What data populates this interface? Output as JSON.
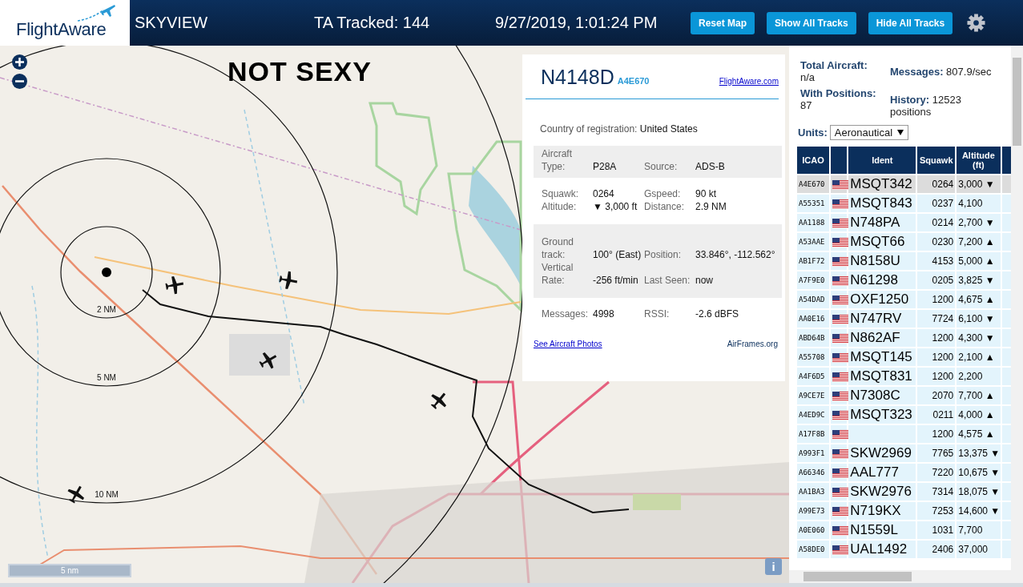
{
  "header": {
    "logo": "FlightAware",
    "app_name": "SKYVIEW",
    "tracked": "TA Tracked: 144",
    "datetime": "9/27/2019, 1:01:24 PM",
    "buttons": [
      "Reset Map",
      "Show All Tracks",
      "Hide All Tracks"
    ]
  },
  "map": {
    "kind": "picture",
    "overlay_title": "NOT SEXY",
    "rings": [
      "2 NM",
      "5 NM",
      "10 NM"
    ],
    "scale": "5 nm",
    "info_button": "i"
  },
  "popup": {
    "title": "N4148D",
    "hex": "A4E670",
    "link": "FlightAware.com",
    "country": {
      "label": "Country of registration:",
      "value": "United States"
    },
    "sections": [
      {
        "shaded": true,
        "fields": [
          {
            "label": "Aircraft Type:",
            "value": "P28A"
          },
          {
            "label": "Source:",
            "value": "ADS-B"
          }
        ]
      },
      {
        "shaded": false,
        "fields": [
          {
            "label": "Squawk:",
            "value": "0264"
          },
          {
            "label": "Gspeed:",
            "value": "90 kt"
          },
          {
            "label": "Altitude:",
            "value": "▼ 3,000 ft"
          },
          {
            "label": "Distance:",
            "value": "2.9 NM"
          }
        ]
      },
      {
        "shaded": true,
        "fields": [
          {
            "label": "Ground track:",
            "value": "100° (East)"
          },
          {
            "label": "Position:",
            "value": "33.846°, -112.562°"
          },
          {
            "label": "Vertical Rate:",
            "value": "-256 ft/min"
          },
          {
            "label": "Last Seen:",
            "value": "now"
          }
        ]
      },
      {
        "shaded": false,
        "fields": [
          {
            "label": "Messages:",
            "value": "4998"
          },
          {
            "label": "RSSI:",
            "value": "-2.6 dBFS"
          }
        ]
      }
    ],
    "photos_link": "See Aircraft Photos",
    "airframes_link": "AirFrames.org"
  },
  "stats": [
    {
      "label": "Total Aircraft:",
      "value": "n/a"
    },
    {
      "label": "Messages:",
      "value": "807.9/sec"
    },
    {
      "label": "With Positions:",
      "value": "87"
    },
    {
      "label": "History:",
      "value": "12523 positions"
    }
  ],
  "units": {
    "label": "Units:",
    "value": "Aeronautical"
  },
  "table": {
    "columns": [
      "ICAO",
      "Ident",
      "Squawk",
      "Altitude (ft)"
    ],
    "rows": [
      {
        "icao": "A4E670",
        "ident": "MSQT342",
        "squawk": "0264",
        "altitude": "3,000 ▼",
        "selected": true
      },
      {
        "icao": "A55351",
        "ident": "MSQT843",
        "squawk": "0237",
        "altitude": "4,100",
        "selected": false
      },
      {
        "icao": "AA1188",
        "ident": "N748PA",
        "squawk": "0214",
        "altitude": "2,700 ▼",
        "selected": false
      },
      {
        "icao": "A53AAE",
        "ident": "MSQT66",
        "squawk": "0230",
        "altitude": "7,200 ▲",
        "selected": false
      },
      {
        "icao": "AB1F72",
        "ident": "N8158U",
        "squawk": "4153",
        "altitude": "5,000 ▲",
        "selected": false
      },
      {
        "icao": "A7F9E0",
        "ident": "N61298",
        "squawk": "0205",
        "altitude": "3,825 ▼",
        "selected": false
      },
      {
        "icao": "A54DAD",
        "ident": "OXF1250",
        "squawk": "1200",
        "altitude": "4,675 ▲",
        "selected": false
      },
      {
        "icao": "AA0E16",
        "ident": "N747RV",
        "squawk": "7724",
        "altitude": "6,100 ▼",
        "selected": false
      },
      {
        "icao": "ABD64B",
        "ident": "N862AF",
        "squawk": "1200",
        "altitude": "4,300 ▼",
        "selected": false
      },
      {
        "icao": "A55708",
        "ident": "MSQT145",
        "squawk": "1200",
        "altitude": "2,100 ▲",
        "selected": false
      },
      {
        "icao": "A4F6D5",
        "ident": "MSQT831",
        "squawk": "1200",
        "altitude": "2,200",
        "selected": false
      },
      {
        "icao": "A9CE7E",
        "ident": "N7308C",
        "squawk": "2070",
        "altitude": "7,700 ▲",
        "selected": false
      },
      {
        "icao": "A4ED9C",
        "ident": "MSQT323",
        "squawk": "0211",
        "altitude": "4,000 ▲",
        "selected": false
      },
      {
        "icao": "A17F8B",
        "squawk": "1200",
        "altitude": "4,575 ▲",
        "selected": false
      },
      {
        "icao": "A993F1",
        "ident": "SKW2969",
        "squawk": "7765",
        "altitude": "13,375 ▼",
        "selected": false
      },
      {
        "icao": "A66346",
        "ident": "AAL777",
        "squawk": "7220",
        "altitude": "10,675 ▼",
        "selected": false
      },
      {
        "icao": "AA1BA3",
        "ident": "SKW2976",
        "squawk": "7314",
        "altitude": "18,075 ▼",
        "selected": false
      },
      {
        "icao": "A99E73",
        "ident": "N719KX",
        "squawk": "7253",
        "altitude": "14,600 ▼",
        "selected": false
      },
      {
        "icao": "A0E060",
        "ident": "N1559L",
        "squawk": "1031",
        "altitude": "7,700",
        "selected": false
      },
      {
        "icao": "A58DE0",
        "ident": "UAL1492",
        "squawk": "2406",
        "altitude": "37,000",
        "selected": false
      }
    ]
  }
}
